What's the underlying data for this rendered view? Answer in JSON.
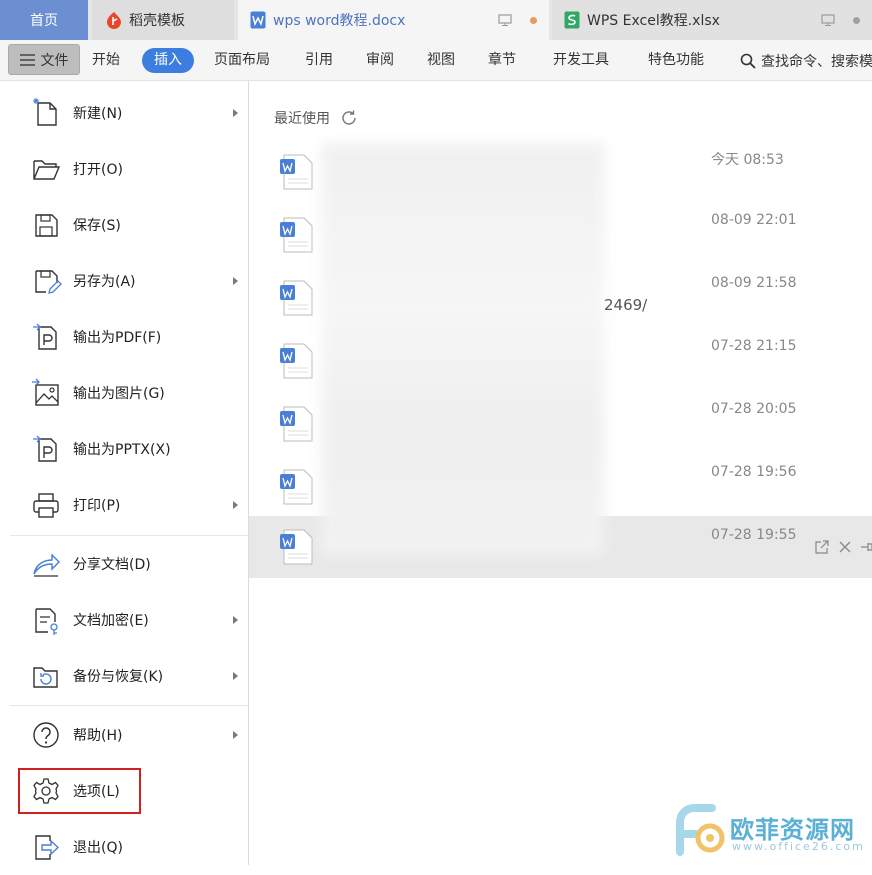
{
  "tabs": {
    "home": "首页",
    "daoke": "稻壳模板",
    "doc": "wps word教程.docx",
    "xls": "WPS Excel教程.xlsx"
  },
  "menubar": {
    "file": "文件",
    "items": [
      "开始",
      "插入",
      "页面布局",
      "引用",
      "审阅",
      "视图",
      "章节",
      "开发工具",
      "特色功能"
    ],
    "search_placeholder": "查找命令、搜索模"
  },
  "file_menu": {
    "items": [
      {
        "label": "新建(N)",
        "icon": "new-doc-icon",
        "arrow": true
      },
      {
        "label": "打开(O)",
        "icon": "folder-open-icon",
        "arrow": false
      },
      {
        "label": "保存(S)",
        "icon": "save-icon",
        "arrow": false
      },
      {
        "label": "另存为(A)",
        "icon": "save-as-icon",
        "arrow": true
      },
      {
        "label": "输出为PDF(F)",
        "icon": "export-pdf-icon",
        "arrow": false
      },
      {
        "label": "输出为图片(G)",
        "icon": "export-image-icon",
        "arrow": false
      },
      {
        "label": "输出为PPTX(X)",
        "icon": "export-pptx-icon",
        "arrow": false
      },
      {
        "label": "打印(P)",
        "icon": "printer-icon",
        "arrow": true
      },
      {
        "label": "分享文档(D)",
        "icon": "share-icon",
        "arrow": false
      },
      {
        "label": "文档加密(E)",
        "icon": "encrypt-icon",
        "arrow": true
      },
      {
        "label": "备份与恢复(K)",
        "icon": "backup-icon",
        "arrow": true
      },
      {
        "label": "帮助(H)",
        "icon": "help-icon",
        "arrow": true
      },
      {
        "label": "选项(L)",
        "icon": "gear-icon",
        "arrow": false
      },
      {
        "label": "退出(Q)",
        "icon": "exit-icon",
        "arrow": false
      }
    ]
  },
  "recent": {
    "title": "最近使用",
    "path_fragment": "2469/",
    "files": [
      {
        "time": "今天 08:53"
      },
      {
        "time": "08-09 22:01"
      },
      {
        "time": "08-09 21:58"
      },
      {
        "time": "07-28 21:15"
      },
      {
        "time": "07-28 20:05"
      },
      {
        "time": "07-28 19:56"
      },
      {
        "time": "07-28 19:55"
      }
    ]
  },
  "watermark": {
    "text": "欧菲资源网",
    "sub": "www.office26.com"
  },
  "colors": {
    "accent": "#3b7ee0",
    "home_tab": "#6b8fd1",
    "highlight_box": "#d02020",
    "word_blue": "#4a7fd6",
    "excel_green": "#2fa866",
    "daoke_red": "#e8462b"
  }
}
